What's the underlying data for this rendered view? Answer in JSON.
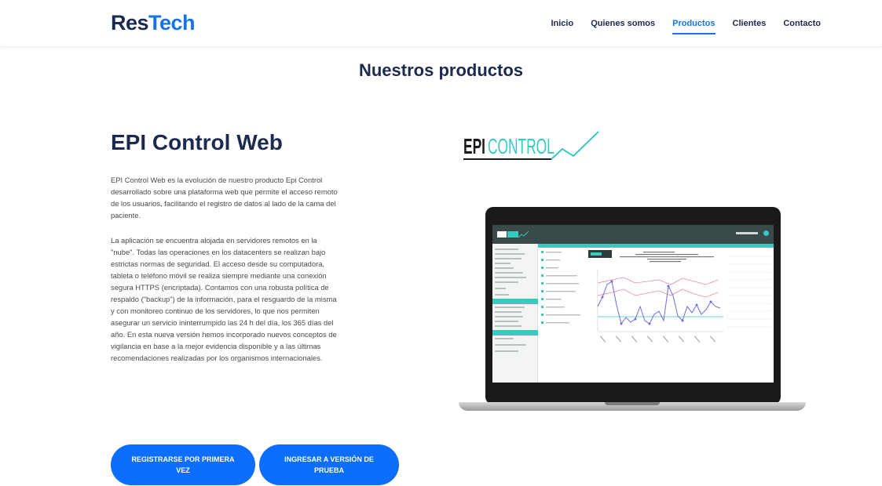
{
  "header": {
    "logo_part1": "Res",
    "logo_part2": "Tech",
    "brand_color": "#1673e6",
    "nav": [
      {
        "label": "Inicio",
        "active": false
      },
      {
        "label": "Quienes somos",
        "active": false
      },
      {
        "label": "Productos",
        "active": true
      },
      {
        "label": "Clientes",
        "active": false
      },
      {
        "label": "Contacto",
        "active": false
      }
    ]
  },
  "main": {
    "section_title": "Nuestros productos",
    "product": {
      "title": "EPI Control Web",
      "paragraph1": "EPI Control Web es la evolución de nuestro producto Epi Control desarrollado sobre una plataforma web que permite el acceso remoto de los usuarios, facilitando el registro de datos al lado de la cama del paciente.",
      "paragraph2": "La aplicación se encuentra alojada en servidores remotos en la \"nube\". Todas las operaciones en los datacenters se realizan bajo estrictas normas de seguridad. El acceso desde su computadora, tableta o teléfono móvil se realiza siempre mediante una conexión segura HTTPS (encriptada). Contamos con una robusta política de respaldo (\"backup\") de la información, para el resguardo de la misma y con monitoreo continuo de los servidores, lo que nos permiten asegurar un servicio ininterrumpido las 24 h del día, los 365 días del año. En esta nueva versión hemos incorporado nuevos conceptos de vigilancia en base a la mejor evidencia disponible y a las últimas recomendaciones realizadas por los organismos internacionales.",
      "buttons": {
        "register": "REGISTRARSE POR PRIMERA VEZ",
        "trial": "INGRESAR A VERSIÓN DE PRUEBA"
      },
      "button_color": "#0d6efd"
    },
    "epi_logo": {
      "part1": "EPI",
      "part2": "CONTROL",
      "accent_color": "#38c9c0"
    },
    "laptop": {
      "icon": "laptop-mockup",
      "accent_color": "#38c9c0"
    }
  }
}
